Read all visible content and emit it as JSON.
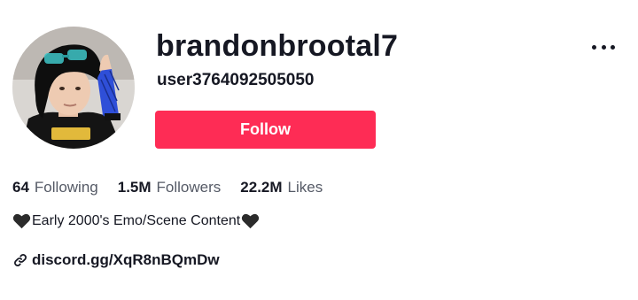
{
  "profile": {
    "username": "brandonbrootal7",
    "handle": "user3764092505050",
    "avatar_alt": "profile-photo"
  },
  "actions": {
    "follow_label": "Follow",
    "more_icon": "more-options-icon"
  },
  "stats": [
    {
      "value": "64",
      "label": "Following"
    },
    {
      "value": "1.5M",
      "label": "Followers"
    },
    {
      "value": "22.2M",
      "label": "Likes"
    }
  ],
  "bio": {
    "text": "Early 2000's Emo/Scene Content",
    "leading_icon": "black-heart-icon",
    "trailing_icon": "black-heart-icon"
  },
  "link": {
    "text": "discord.gg/XqR8nBQmDw",
    "icon": "link-icon"
  },
  "colors": {
    "follow_button": "#fe2c55",
    "text_primary": "#161823",
    "text_secondary": "#555a66",
    "background": "#ffffff"
  }
}
